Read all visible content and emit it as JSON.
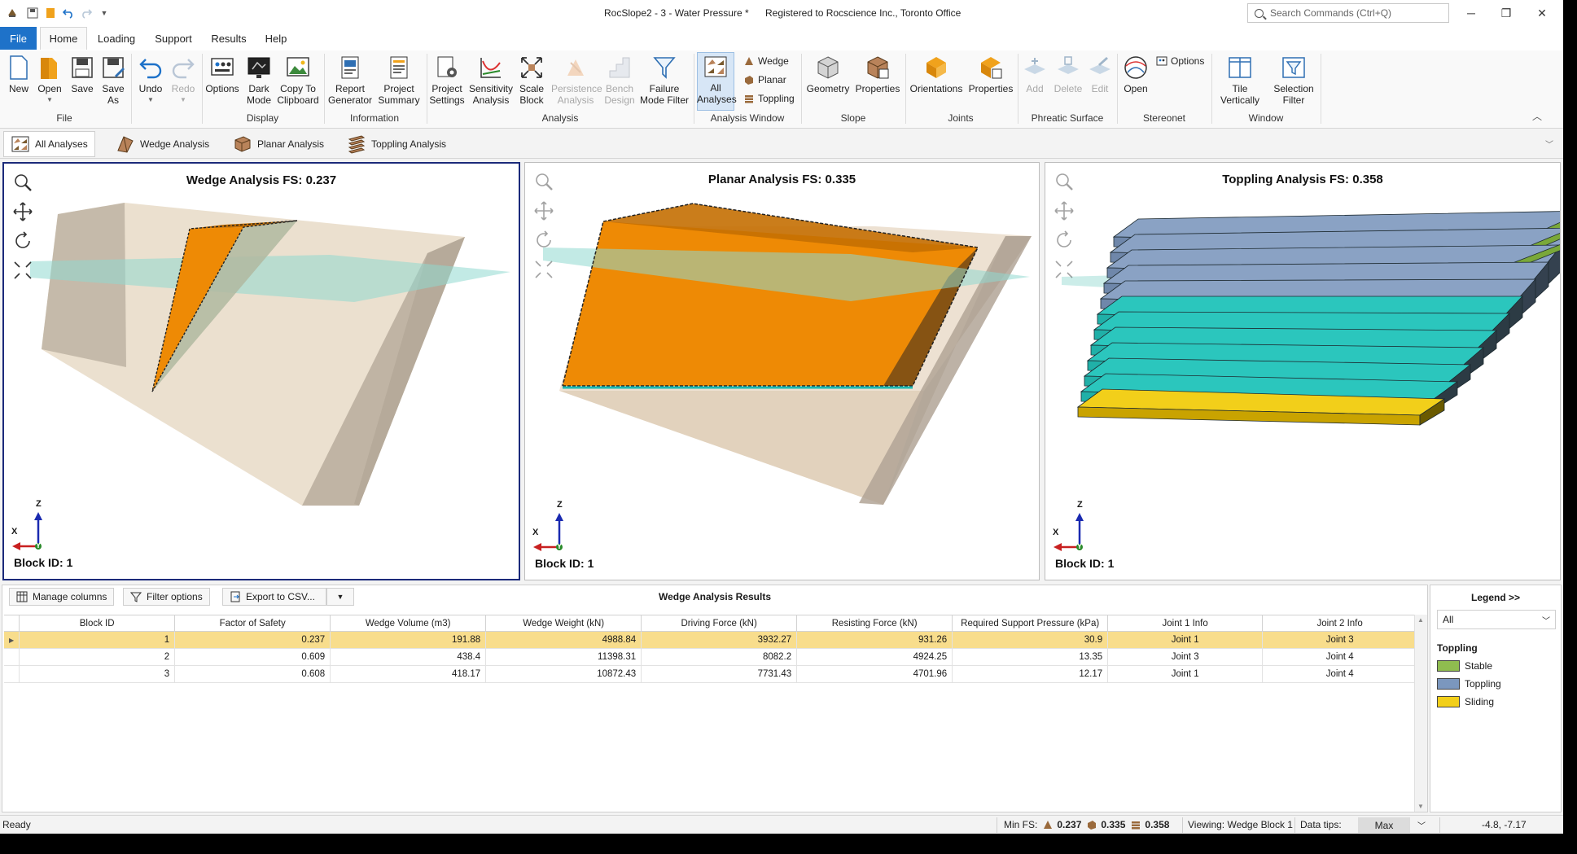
{
  "titlebar": {
    "title": "RocSlope2 - 3 - Water Pressure *",
    "registered": "Registered to Rocscience Inc., Toronto Office",
    "search_placeholder": "Search Commands (Ctrl+Q)",
    "quick_access": [
      "app-icon",
      "save-icon",
      "open-icon",
      "undo-icon",
      "redo-icon",
      "customize-icon"
    ]
  },
  "ribbon_tabs": [
    "File",
    "Home",
    "Loading",
    "Support",
    "Results",
    "Help"
  ],
  "ribbon": {
    "file": {
      "label": "File",
      "buttons": [
        "New",
        "Open",
        "Save",
        "Save As"
      ]
    },
    "undo": "Undo",
    "redo": "Redo",
    "display": {
      "label": "Display",
      "buttons": [
        "Options",
        "Dark Mode",
        "Copy To Clipboard"
      ]
    },
    "information": {
      "label": "Information",
      "buttons": [
        "Report Generator",
        "Project Summary"
      ]
    },
    "analysis": {
      "label": "Analysis",
      "buttons": [
        "Project Settings",
        "Sensitivity Analysis",
        "Scale Block",
        "Persistence Analysis",
        "Bench Design",
        "Failure Mode Filter"
      ]
    },
    "analysis_window": {
      "label": "Analysis Window",
      "all": "All Analyses",
      "wedge": "Wedge",
      "planar": "Planar",
      "toppling": "Toppling"
    },
    "slope": {
      "label": "Slope",
      "buttons": [
        "Geometry",
        "Properties"
      ]
    },
    "joints": {
      "label": "Joints",
      "buttons": [
        "Orientations",
        "Properties"
      ]
    },
    "phreatic": {
      "label": "Phreatic Surface",
      "buttons": [
        "Add",
        "Delete",
        "Edit"
      ]
    },
    "stereonet": {
      "label": "Stereonet",
      "open": "Open",
      "options": "Options"
    },
    "window": {
      "label": "Window",
      "buttons": [
        "Tile Vertically",
        "Selection Filter"
      ]
    }
  },
  "analysis_tabs": [
    "All Analyses",
    "Wedge Analysis",
    "Planar Analysis",
    "Toppling Analysis"
  ],
  "viewports": [
    {
      "title": "Wedge Analysis FS: 0.237",
      "block": "Block ID: 1"
    },
    {
      "title": "Planar Analysis FS: 0.335",
      "block": "Block ID: 1"
    },
    {
      "title": "Toppling Analysis FS: 0.358",
      "block": "Block ID: 1"
    }
  ],
  "axes": {
    "x": "X",
    "y": "Y",
    "z": "Z"
  },
  "results": {
    "title": "Wedge Analysis Results",
    "manage_columns": "Manage columns",
    "filter_options": "Filter options",
    "export": "Export to CSV...",
    "columns": [
      "Block ID",
      "Factor of Safety",
      "Wedge Volume (m3)",
      "Wedge Weight (kN)",
      "Driving Force (kN)",
      "Resisting Force (kN)",
      "Required Support Pressure (kPa)",
      "Joint 1 Info",
      "Joint 2 Info"
    ],
    "rows": [
      [
        "1",
        "0.237",
        "191.88",
        "4988.84",
        "3932.27",
        "931.26",
        "30.9",
        "Joint 1",
        "Joint 3"
      ],
      [
        "2",
        "0.609",
        "438.4",
        "11398.31",
        "8082.2",
        "4924.25",
        "13.35",
        "Joint 3",
        "Joint 4"
      ],
      [
        "3",
        "0.608",
        "418.17",
        "10872.43",
        "7731.43",
        "4701.96",
        "12.17",
        "Joint 1",
        "Joint 4"
      ]
    ],
    "selected_row": 0
  },
  "legend": {
    "title": "Legend >>",
    "filter": "All",
    "section": "Toppling",
    "items": [
      {
        "label": "Stable",
        "color": "#8fbc4f"
      },
      {
        "label": "Toppling",
        "color": "#7b97be"
      },
      {
        "label": "Sliding",
        "color": "#f2cf1a"
      }
    ]
  },
  "status": {
    "ready": "Ready",
    "min_fs_label": "Min FS:",
    "fs_values": [
      "0.237",
      "0.335",
      "0.358"
    ],
    "viewing": "Viewing: Wedge Block 1",
    "data_tips_label": "Data tips:",
    "data_tips_value": "Max",
    "coords": "-4.8, -7.17"
  },
  "colors": {
    "orange": "#ee8a05",
    "rock": "#e7d9c6",
    "water": "#8fd8cf",
    "accent_blue": "#1e72c9",
    "active_border": "#1b2a7a"
  }
}
